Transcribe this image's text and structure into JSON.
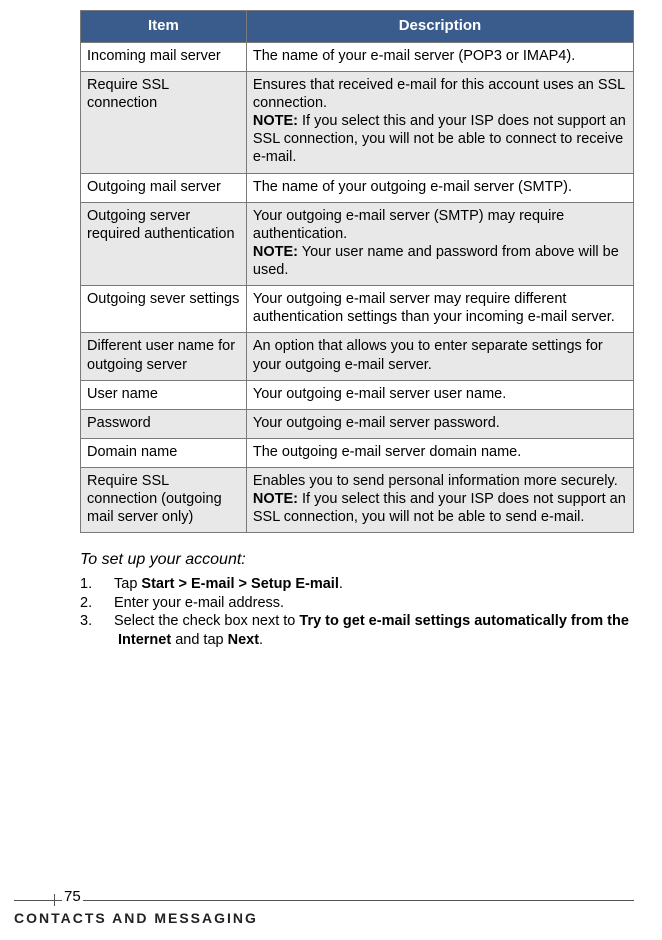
{
  "table": {
    "headers": {
      "item": "Item",
      "description": "Description"
    },
    "rows": [
      {
        "item": "Incoming mail server",
        "desc": "The name of your e-mail server (POP3 or IMAP4).",
        "shaded": false
      },
      {
        "item": "Require SSL connection",
        "desc_pre": "Ensures that received e-mail for this account uses an SSL connection.",
        "note": "If you select this and your ISP does not support an SSL connection, you will not be able to connect to receive e-mail.",
        "shaded": true
      },
      {
        "item": "Outgoing mail server",
        "desc": "The name of your outgoing e-mail server (SMTP).",
        "shaded": false
      },
      {
        "item": "Outgoing server required authentication",
        "desc_pre": "Your outgoing e-mail server (SMTP) may require authentication.",
        "note": "Your user name and password from above will be used.",
        "shaded": true
      },
      {
        "item": "Outgoing sever settings",
        "desc": "Your outgoing e-mail server may require different authentication settings than your incoming e-mail server.",
        "shaded": false
      },
      {
        "item": "Different user name for outgoing server",
        "desc": "An option that allows you to enter separate settings for your outgoing e-mail server.",
        "shaded": true
      },
      {
        "item": "User name",
        "desc": "Your outgoing e-mail server user name.",
        "shaded": false
      },
      {
        "item": "Password",
        "desc": "Your outgoing e-mail server password.",
        "shaded": true
      },
      {
        "item": "Domain name",
        "desc": "The outgoing e-mail server domain name.",
        "shaded": false
      },
      {
        "item": "Require SSL connection (outgoing mail server only)",
        "desc_pre": "Enables you to send personal information more securely.",
        "note": "If you select this and your ISP does not support an SSL connection, you will not be able to send e-mail.",
        "shaded": true
      }
    ]
  },
  "note_label": "NOTE:",
  "section_heading": "To set up your account:",
  "steps": {
    "s1_pre": "Tap ",
    "s1_b": "Start > E-mail > Setup E-mail",
    "s1_post": ".",
    "s2": "Enter your e-mail address.",
    "s3_pre": "Select the check box next to ",
    "s3_b1": "Try to get e-mail settings automatically from the Internet",
    "s3_mid": " and tap ",
    "s3_b2": "Next",
    "s3_post": "."
  },
  "footer": {
    "page_number": "75",
    "section": "Contacts and Messaging"
  }
}
